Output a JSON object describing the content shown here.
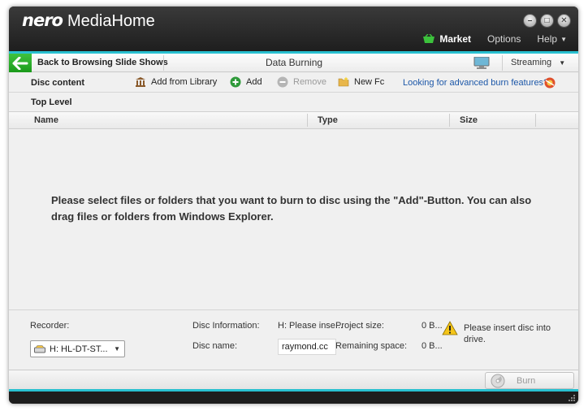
{
  "app": {
    "brand": "nero",
    "name": "MediaHome"
  },
  "window_controls": {
    "minimize": "–",
    "maximize": "□",
    "close": "✕"
  },
  "top_menu": {
    "market": "Market",
    "options": "Options",
    "help": "Help"
  },
  "nav": {
    "back_label": "Back to Browsing Slide Shows",
    "title": "Data Burning",
    "streaming": "Streaming"
  },
  "toolbar": {
    "label": "Disc content",
    "add_from_library": "Add from Library",
    "add": "Add",
    "remove": "Remove",
    "new_folder": "New Fc",
    "advanced_link": "Looking for advanced burn features?"
  },
  "level": "Top Level",
  "columns": [
    "Name",
    "Type",
    "Size"
  ],
  "empty_message": "Please select files or folders that you want to burn to disc using the \"Add\"-Button. You can also drag files or folders from Windows Explorer.",
  "bottom": {
    "recorder_label": "Recorder:",
    "recorder_value": "H: HL-DT-ST...",
    "disc_info_label": "Disc Information:",
    "disc_info_value": "H: Please inse...",
    "disc_name_label": "Disc name:",
    "disc_name_value": "raymond.cc",
    "project_size_label": "Project size:",
    "project_size_value": "0 B...",
    "remaining_label": "Remaining space:",
    "remaining_value": "0 B...",
    "warning_text": "Please insert disc into drive."
  },
  "footer": {
    "burn_label": "Burn"
  },
  "colors": {
    "accent": "#29c0d0",
    "back_green": "#1fa01f",
    "link": "#1c57a8"
  }
}
